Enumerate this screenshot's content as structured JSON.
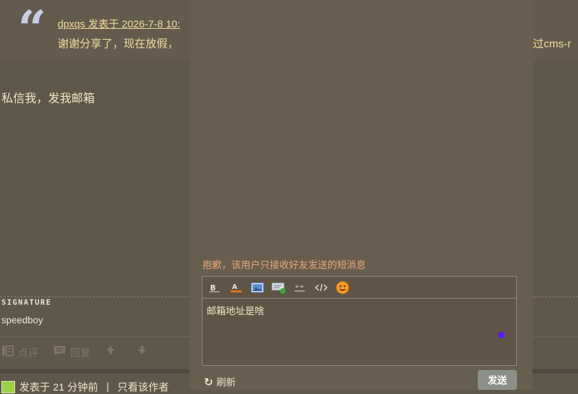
{
  "quote": {
    "meta": "dpxqs 发表于 2026-7-8 10:",
    "text": "谢谢分享了，现在放假，",
    "text_tail": "过cms-r"
  },
  "post": {
    "body": "私信我，发我邮箱",
    "signature_label": "SIGNATURE",
    "signature": "speedboy",
    "actions": {
      "rate": "点评",
      "reply": "回复"
    },
    "footer": {
      "posted": "发表于 21 分钟前",
      "separator": "|",
      "only_author": "只看该作者"
    }
  },
  "dialog": {
    "notice": "抱歉，该用户只接收好友发送的短消息",
    "toolbar": [
      "bold",
      "font-color",
      "image",
      "link",
      "quote",
      "code",
      "smiley"
    ],
    "message": "邮箱地址是啥",
    "refresh_label": "刷新",
    "send_label": "发送",
    "colors": {
      "notice": "#e8a779",
      "send_button": "#8c9088"
    }
  }
}
